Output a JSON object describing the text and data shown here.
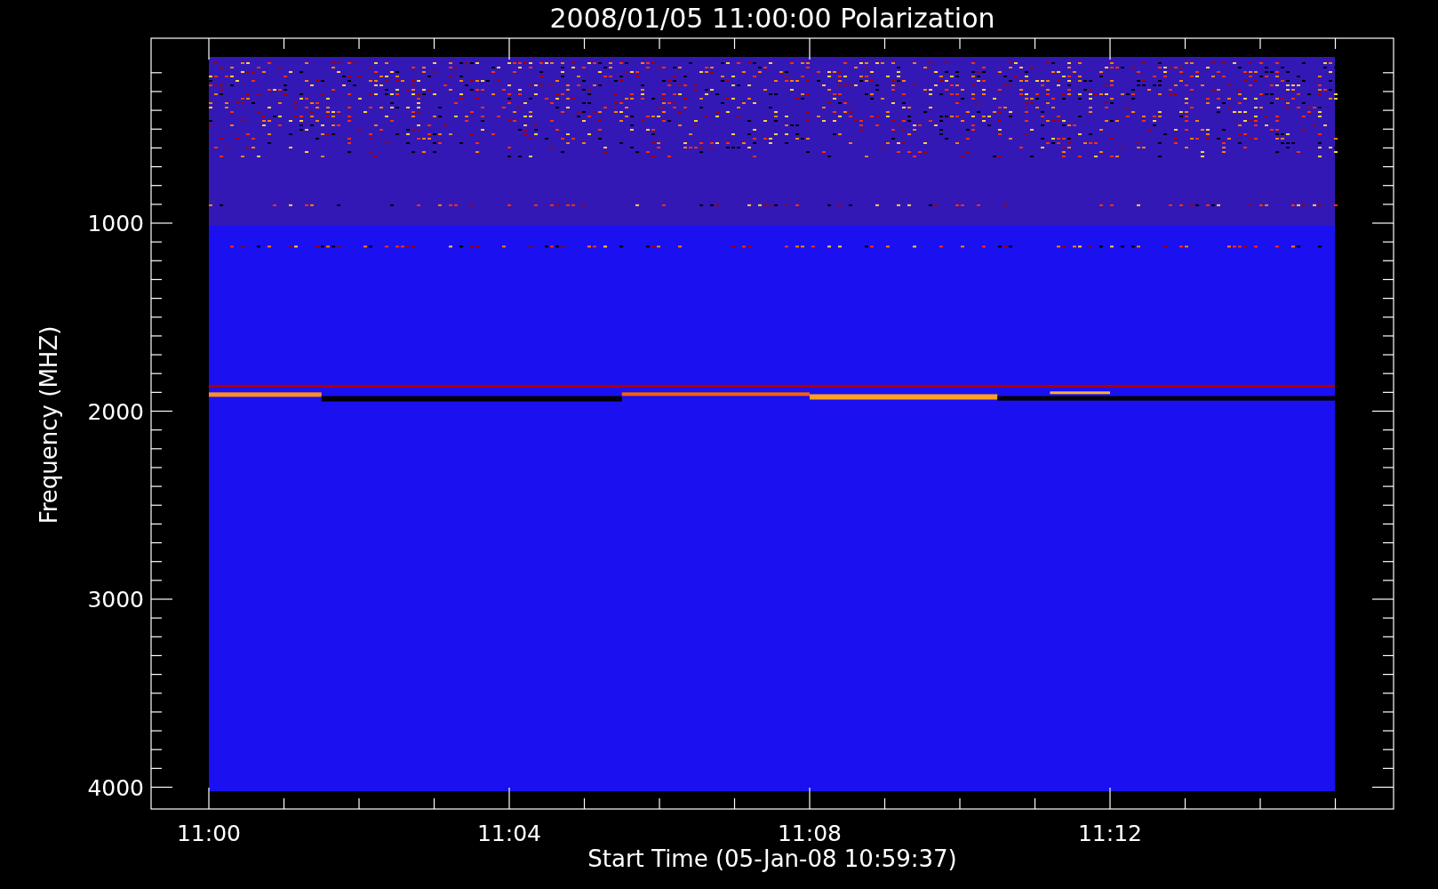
{
  "title": "2008/01/05 11:00:00 Polarization",
  "y_axis": {
    "label": "Frequency (MHZ)",
    "ticks": [
      "1000",
      "2000",
      "3000",
      "4000"
    ]
  },
  "x_axis": {
    "label": "Start Time (05-Jan-08 10:59:37)",
    "ticks": [
      "11:00",
      "11:04",
      "11:08",
      "11:12"
    ]
  }
}
